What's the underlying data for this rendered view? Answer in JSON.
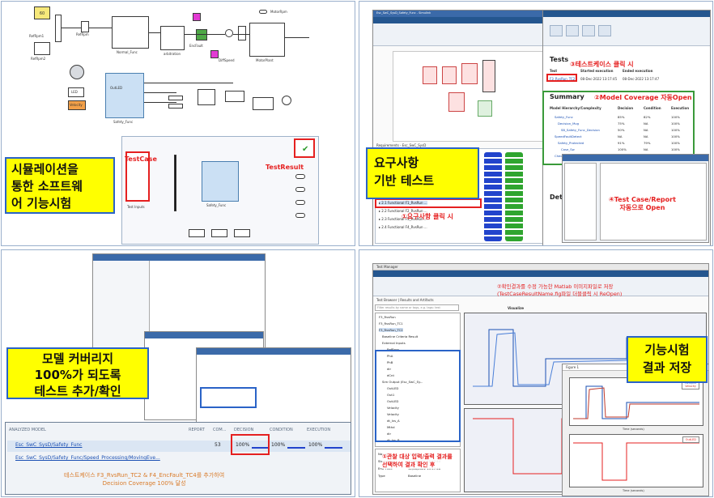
{
  "q1": {
    "callout": "시뮬레이션을\n통한 소프트웨\n어 기능시험",
    "testcase_label": "TestCase",
    "testresult_label": "TestResult",
    "blocks": {
      "refrpm": "RefRpm",
      "func": "Normal_Func",
      "arbitration": "arbitration",
      "encfault": "EncFault",
      "diffspeed": "DiffSpeed",
      "motorplant": "MotorPlant",
      "safety": "Safety_Func",
      "motorrpm": "MotorRpm",
      "outled": "OutLED",
      "velocity": "Velocity",
      "led": "LED",
      "refrpm1": "RefRpm1",
      "refrpm2": "RefRpm2",
      "refrpm_out": "RefRpm"
    },
    "const_value": "60"
  },
  "q2": {
    "callout": "요구사항\n기반 테스트",
    "step1": "①요구사항 클릭 시",
    "step2": "②Model Coverage 자동Open",
    "step3": "③테스트케이스 클릭 시",
    "step4": "④Test Case/Report\n자동으로 Open",
    "tests_heading": "Tests",
    "summary_heading": "Summary",
    "test_col": "Test",
    "started_col": "Started execution",
    "ended_col": "Ended execution",
    "test_row": "F3_RvsRun_TC2",
    "started_val": "08-Dec-2022 13:17:45",
    "ended_val": "08-Dec-2022 13:17:47",
    "model_hierarchy": "Model Hierarchy/Complexity",
    "decision_col": "Decision",
    "condition_col": "Condition",
    "execution_col": "Execution",
    "summary_rows": [
      {
        "name": "Safety_Func",
        "dec": "85%",
        "cond": "82%",
        "exec": "100%"
      },
      {
        "name": "Decision_Mvg",
        "dec": "75%",
        "cond": "NA",
        "exec": "100%"
      },
      {
        "name": "SB_Safety_Func_Decision",
        "dec": "50%",
        "cond": "NA",
        "exec": "100%"
      },
      {
        "name": "SpeedFaultDetect",
        "dec": "NA",
        "cond": "NA",
        "exec": "100%"
      },
      {
        "name": "Safety_Protected",
        "dec": "91%",
        "cond": "79%",
        "exec": "100%"
      },
      {
        "name": "Case_Sw",
        "dec": "100%",
        "cond": "NA",
        "exec": "100%"
      },
      {
        "name": "Check",
        "dec": "100%",
        "cond": "NA",
        "exec": "100%"
      }
    ],
    "requirements_title": "Requirements - Esc_SwC_SysD",
    "window_title": "Esc_SwC_SysD_Safety_Func - Simulink"
  },
  "q3": {
    "callout": "모델 커버리지\n100%가 되도록\n테스트 추가/확인",
    "analyzed_model": "ANALYZED MODEL",
    "report_col": "REPORT",
    "com_col": "COM...",
    "decision_col": "DECISION",
    "condition_col": "CONDITION",
    "execution_col": "EXECUTION",
    "row1_name": "Esc_SwC_SysD/Safety_Func",
    "row1_com": "53",
    "row1_dec": "100%",
    "row1_cond": "100%",
    "row1_exec": "100%",
    "row2_name": "Esc_SwC_SysD/Safety_Func/Speed_Processing/MovingEve...",
    "note": "테스트케이스 F3_RvsRun_TC2 & F4_EncFault_TC4를 추가하여\nDecision Coverage 100% 달성",
    "row1_dec_val": 100,
    "row1_cond_val": 100,
    "row1_exec_val": 100
  },
  "q4": {
    "callout": "기능시험\n결과 저장",
    "note_top": "②확인결과를 수정 가능한 Matlab 이미지파일로 저장\n(TestCaseResultName.fig파일 더블클릭 시 ReOpen)",
    "step1": "①관찰 대상 입력/출력 결과를\n선택하여 결과 확인 후",
    "app_title": "Test Manager",
    "tabs": [
      "TESTS",
      "DATA INSPECTOR",
      "FORMAT"
    ],
    "panel_title": "Test Browser | Results and Artifacts",
    "filter_placeholder": "Filter results by name or tags, e.g. tags: test",
    "tree": [
      "F3_RvsRun",
      "F3_RvsRun_TC1",
      "F3_RvsRun_TC2",
      "Baseline Criteria Result",
      "External Inputs",
      "RefRpm",
      "PhA",
      "PhB",
      "dir",
      "dCnt",
      "Sim Output (Esc_SwC_Sy...",
      "OutLED",
      "Out1",
      "OutLED",
      "Velocity",
      "Velocity",
      "dt_Ivs_A",
      "Mthd",
      "dir",
      "dt_Ivs_B"
    ],
    "figure_title": "Figure 1",
    "legend_top": [
      "RefRpm",
      "Velocity"
    ],
    "legend_bottom": [
      "OutLED"
    ],
    "x_label": "Time (seconds)",
    "props": [
      {
        "k": "Name",
        "v": "Velocity"
      },
      {
        "k": "Start Time",
        "v": "12/08/2022 15:17:44"
      },
      {
        "k": "End Time",
        "v": "12/08/2022 15:17:46"
      },
      {
        "k": "Type",
        "v": "Baseline"
      }
    ],
    "inline_tab": "Visualize"
  }
}
